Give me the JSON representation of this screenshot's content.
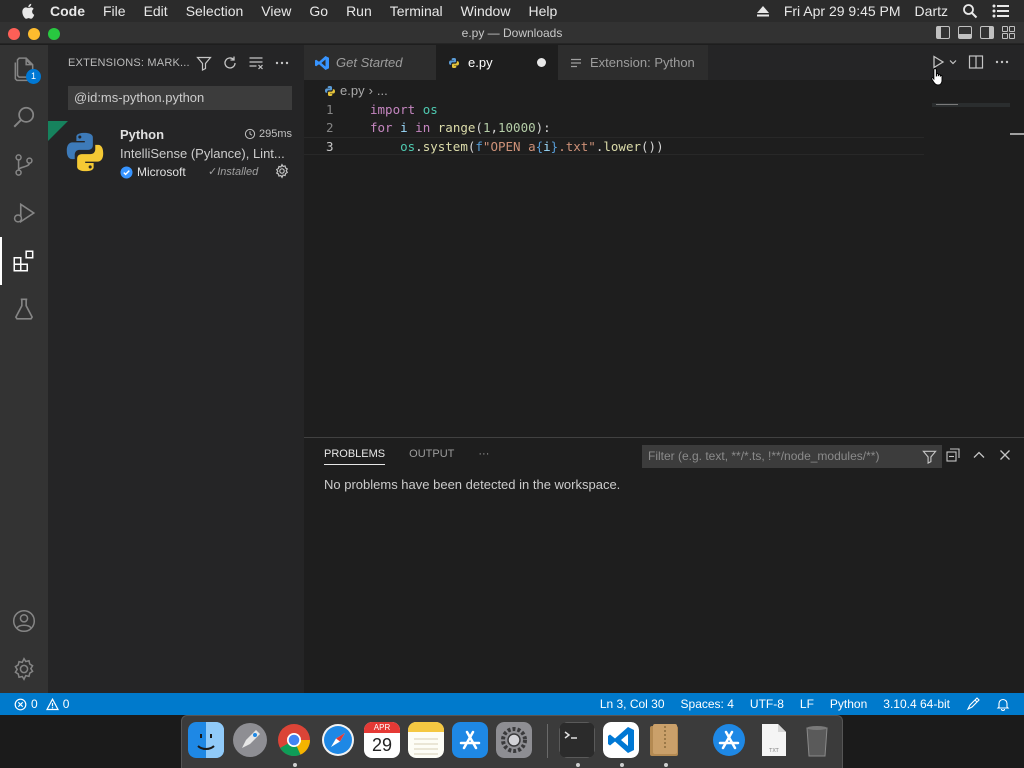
{
  "menubar": {
    "app": "Code",
    "items": [
      "File",
      "Edit",
      "Selection",
      "View",
      "Go",
      "Run",
      "Terminal",
      "Window",
      "Help"
    ],
    "datetime": "Fri Apr 29  9:45 PM",
    "user": "Dartz"
  },
  "window": {
    "title": "e.py — Downloads"
  },
  "activitybar": {
    "explorer_badge": "1"
  },
  "sidebar": {
    "title": "EXTENSIONS: MARK...",
    "search_value": "@id:ms-python.python",
    "extension": {
      "name": "Python",
      "time": "295ms",
      "description": "IntelliSense (Pylance), Lint...",
      "publisher": "Microsoft",
      "status": "Installed"
    }
  },
  "editor": {
    "tabs": [
      {
        "label": "Get Started"
      },
      {
        "label": "e.py"
      },
      {
        "label": "Extension: Python"
      }
    ],
    "breadcrumb": {
      "file": "e.py",
      "more": "..."
    },
    "line_numbers": [
      "1",
      "2",
      "3"
    ]
  },
  "panel": {
    "tabs": [
      "PROBLEMS",
      "OUTPUT"
    ],
    "more": "···",
    "filter_placeholder": "Filter (e.g. text, **/*.ts, !**/node_modules/**)",
    "message": "No problems have been detected in the workspace."
  },
  "statusbar": {
    "errors": "0",
    "warnings": "0",
    "position": "Ln 3, Col 30",
    "spaces": "Spaces: 4",
    "encoding": "UTF-8",
    "eol": "LF",
    "language": "Python",
    "interpreter": "3.10.4 64-bit"
  },
  "dock": {
    "calendar_month": "APR",
    "calendar_day": "29"
  },
  "colors": {
    "accent": "#007acc",
    "installed_corner": "#16825d"
  }
}
